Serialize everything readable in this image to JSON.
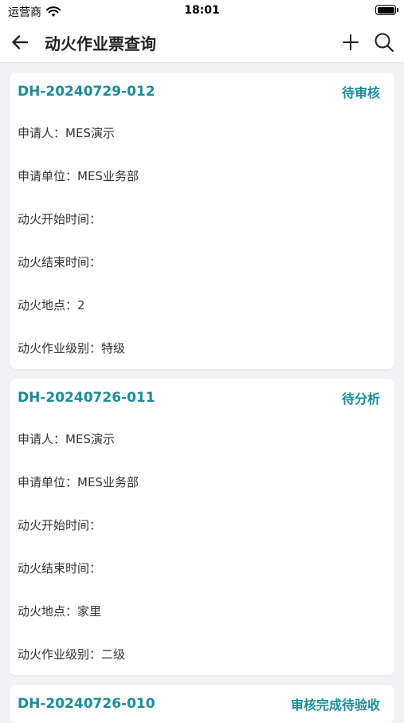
{
  "status_bar": {
    "carrier": "运营商",
    "time": "18:01"
  },
  "nav": {
    "title": "动火作业票查询",
    "back_icon": "arrow-left-icon",
    "add_icon": "plus-icon",
    "search_icon": "search-icon"
  },
  "colors": {
    "accent": "#1b8c99",
    "background": "#f2f2f4"
  },
  "tickets": [
    {
      "number": "DH-20240729-012",
      "status": "待审核",
      "fields": [
        "申请人：MES演示",
        "申请单位：MES业务部",
        "动火开始时间：",
        "动火结束时间：",
        "动火地点：2",
        "动火作业级别：特级"
      ]
    },
    {
      "number": "DH-20240726-011",
      "status": "待分析",
      "fields": [
        "申请人：MES演示",
        "申请单位：MES业务部",
        "动火开始时间：",
        "动火结束时间：",
        "动火地点：家里",
        "动火作业级别：二级"
      ]
    },
    {
      "number": "DH-20240726-010",
      "status": "审核完成待验收",
      "fields": []
    }
  ]
}
